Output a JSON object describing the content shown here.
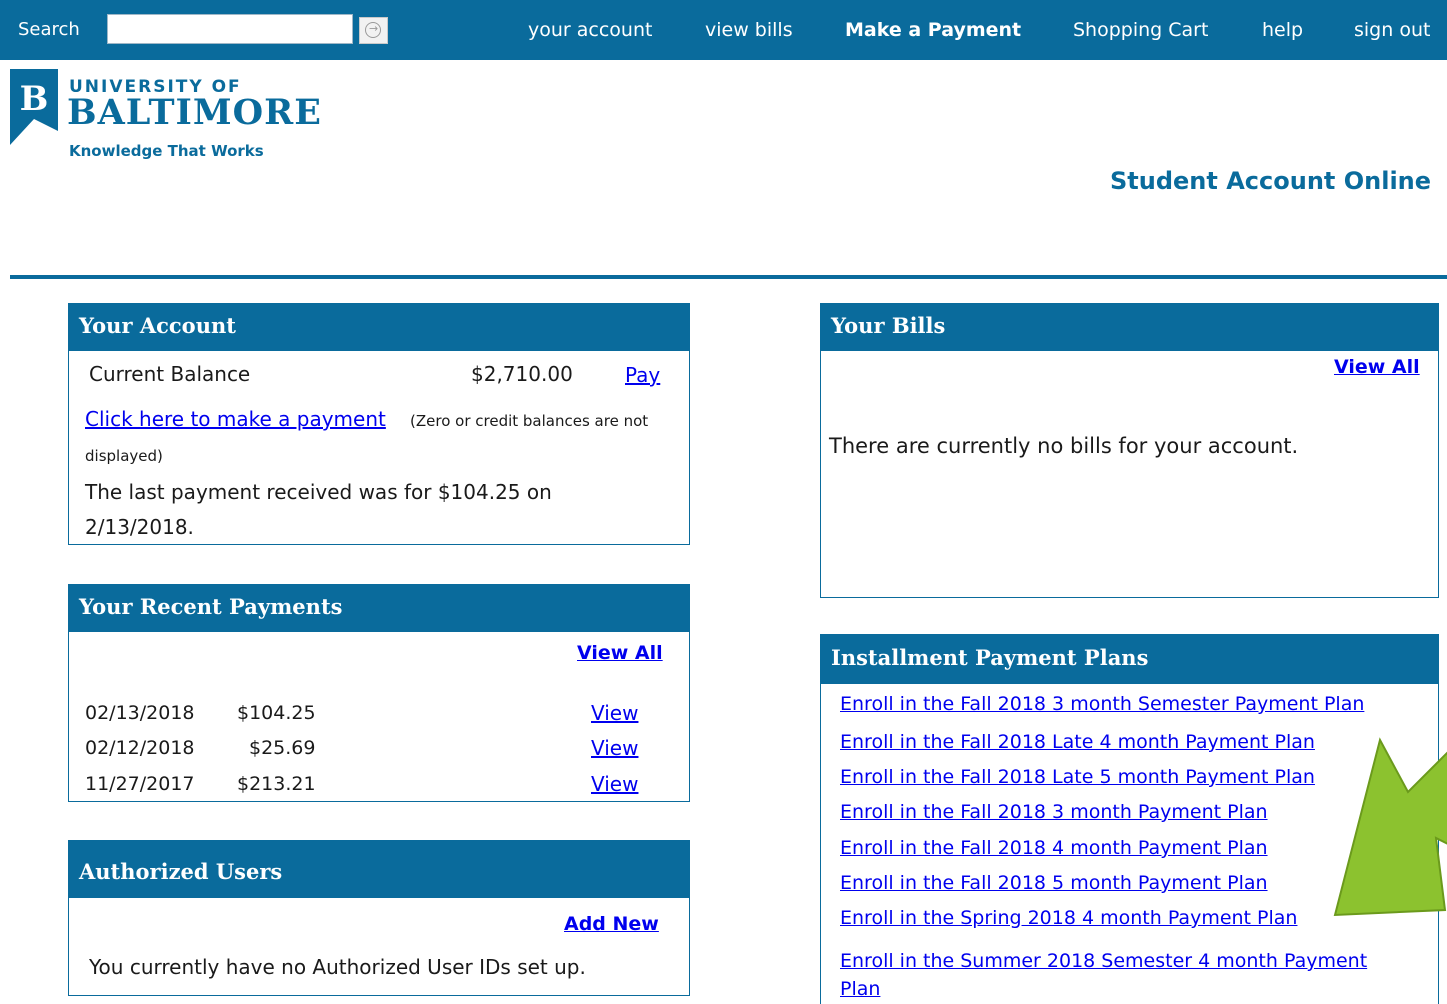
{
  "topbar": {
    "search_label": "Search",
    "search_value": "",
    "nav": [
      "your account",
      "view bills",
      "Make a Payment",
      "Shopping Cart",
      "help",
      "sign out"
    ]
  },
  "logo": {
    "line1": "UNIVERSITY OF",
    "line2": "BALTIMORE",
    "tagline": "Knowledge That Works"
  },
  "site_title": "Student Account Online",
  "your_account": {
    "title": "Your Account",
    "balance_label": "Current Balance",
    "balance_value": "$2,710.00",
    "pay_link": "Pay",
    "payment_link": "Click here to make a payment",
    "payment_note_1": "(Zero or credit balances are not",
    "payment_note_2": "displayed)",
    "last_payment_1": "The last payment received was for $104.25 on",
    "last_payment_2": "2/13/2018."
  },
  "recent_payments": {
    "title": "Your Recent Payments",
    "view_all": "View All",
    "rows": [
      {
        "date": "02/13/2018",
        "amount": "$104.25",
        "action": "View"
      },
      {
        "date": "02/12/2018",
        "amount": "$25.69",
        "action": "View"
      },
      {
        "date": "11/27/2017",
        "amount": "$213.21",
        "action": "View"
      }
    ]
  },
  "authorized_users": {
    "title": "Authorized Users",
    "add_new": "Add New",
    "message": "You currently have no Authorized User IDs set up."
  },
  "your_bills": {
    "title": "Your Bills",
    "view_all": "View All",
    "message": "There are currently no bills for your account."
  },
  "installment_plans": {
    "title": "Installment Payment Plans",
    "links": [
      "Enroll in the Fall 2018 3 month Semester Payment Plan",
      "Enroll in the Fall 2018 Late 4 month Payment Plan",
      "Enroll in the Fall 2018 Late 5 month Payment Plan",
      "Enroll in the Fall 2018 3 month Payment Plan",
      "Enroll in the Fall 2018 4 month Payment Plan",
      "Enroll in the Fall 2018 5 month Payment Plan",
      "Enroll in the Spring 2018 4 month Payment Plan",
      "Enroll in the Summer 2018 Semester 4 month Payment"
    ],
    "last_link_wrap": "Plan"
  },
  "colors": {
    "brand_blue": "#0a6b9c",
    "link_blue": "#0000ee",
    "arrow_green": "#8cc22f"
  }
}
